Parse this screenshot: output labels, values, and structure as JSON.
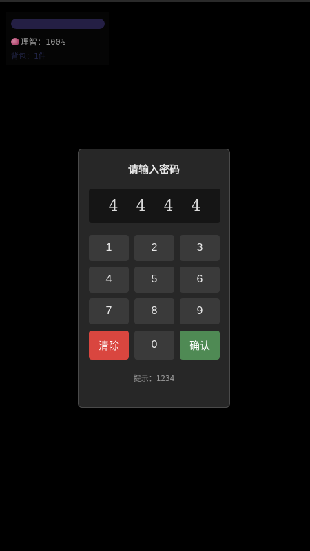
{
  "hud": {
    "sanity_label": "理智：",
    "sanity_value": "100%",
    "sanity_fraction": 1.0,
    "items_label": "背包：",
    "items_count": "1件",
    "colors": {
      "sanity_bar": "#241f44",
      "brain_icon": "#b0486f"
    }
  },
  "dialog": {
    "title": "请输入密码",
    "entered_digits": [
      "4",
      "4",
      "4",
      "4"
    ],
    "keypad": {
      "k1": "1",
      "k2": "2",
      "k3": "3",
      "k4": "4",
      "k5": "5",
      "k6": "6",
      "k7": "7",
      "k8": "8",
      "k9": "9",
      "clear": "清除",
      "k0": "0",
      "confirm": "确认"
    },
    "hint": "提示：1234",
    "colors": {
      "clear": "#d9463f",
      "confirm": "#4f8a54",
      "key": "#3a3a3a",
      "panel": "#272727"
    }
  }
}
